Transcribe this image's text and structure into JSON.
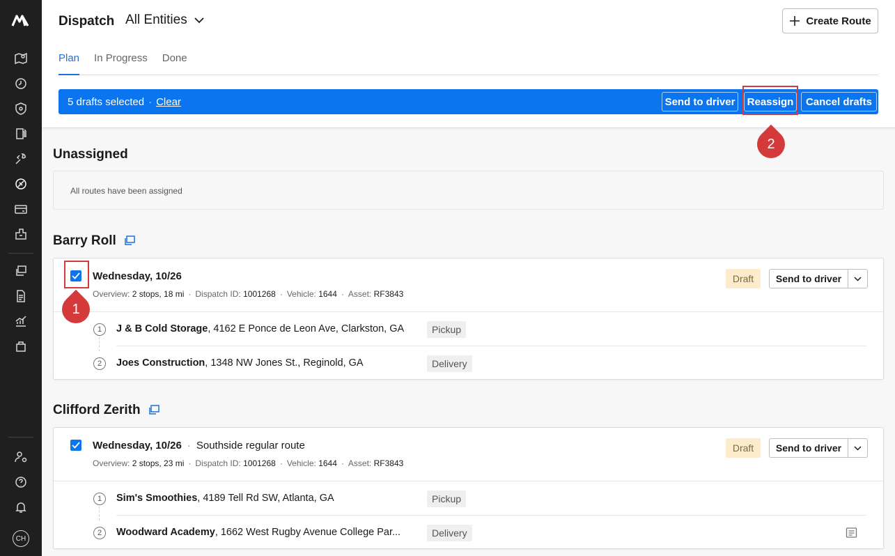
{
  "header": {
    "title": "Dispatch",
    "entity_select": "All Entities",
    "create_button": "Create Route"
  },
  "tabs": [
    {
      "label": "Plan",
      "active": true
    },
    {
      "label": "In Progress",
      "active": false
    },
    {
      "label": "Done",
      "active": false
    }
  ],
  "selection_bar": {
    "count_text": "5 drafts selected",
    "separator": "·",
    "clear_label": "Clear",
    "send_to_driver": "Send to driver",
    "reassign": "Reassign",
    "cancel_drafts": "Cancel drafts"
  },
  "callouts": [
    "1",
    "2"
  ],
  "unassigned": {
    "title": "Unassigned",
    "empty_text": "All routes have been assigned"
  },
  "drivers": [
    {
      "name": "Barry Roll",
      "route": {
        "checked": true,
        "date": "Wednesday, 10/26",
        "note": "",
        "overview_label": "Overview:",
        "overview_value": "2 stops, 18 mi",
        "dispatch_label": "Dispatch ID:",
        "dispatch_value": "1001268",
        "vehicle_label": "Vehicle:",
        "vehicle_value": "1644",
        "asset_label": "Asset:",
        "asset_value": "RF3843",
        "status": "Draft",
        "send_label": "Send to driver",
        "stops": [
          {
            "num": "1",
            "name": "J & B Cold Storage",
            "address": ", 4162 E Ponce de Leon Ave, Clarkston, GA",
            "type": "Pickup"
          },
          {
            "num": "2",
            "name": "Joes Construction",
            "address": ", 1348 NW Jones St., Reginold, GA",
            "type": "Delivery"
          }
        ]
      }
    },
    {
      "name": "Clifford Zerith",
      "route": {
        "checked": true,
        "date": "Wednesday, 10/26",
        "note": "Southside regular route",
        "overview_label": "Overview:",
        "overview_value": "2 stops, 23 mi",
        "dispatch_label": "Dispatch ID:",
        "dispatch_value": "1001268",
        "vehicle_label": "Vehicle:",
        "vehicle_value": "1644",
        "asset_label": "Asset:",
        "asset_value": "RF3843",
        "status": "Draft",
        "send_label": "Send to driver",
        "stops": [
          {
            "num": "1",
            "name": "Sim's Smoothies",
            "address": ", 4189 Tell Rd SW, Atlanta, GA",
            "type": "Pickup"
          },
          {
            "num": "2",
            "name": "Woodward Academy",
            "address": ", 1662 West Rugby Avenue College Par...",
            "type": "Delivery"
          }
        ]
      }
    }
  ],
  "sidebar": {
    "avatar_initials": "CH",
    "icons": [
      "map-icon",
      "clock-icon",
      "shield-icon",
      "fuel-icon",
      "wrench-icon",
      "route-tag-icon",
      "card-icon",
      "warehouse-icon",
      "messages-icon",
      "document-icon",
      "chart-icon",
      "bag-icon",
      "user-settings-icon",
      "help-icon",
      "bell-icon"
    ]
  }
}
